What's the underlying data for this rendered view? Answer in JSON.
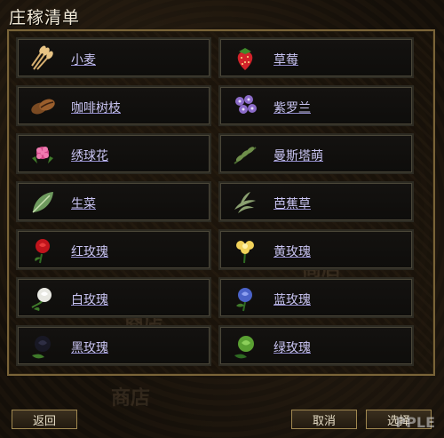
{
  "window": {
    "title": "庄稼清单"
  },
  "crops": [
    {
      "label": "小麦",
      "icon": "wheat-icon"
    },
    {
      "label": "草莓",
      "icon": "strawberry-icon"
    },
    {
      "label": "咖啡树枝",
      "icon": "coffee-bean-icon"
    },
    {
      "label": "紫罗兰",
      "icon": "violet-icon"
    },
    {
      "label": "绣球花",
      "icon": "hydrangea-icon"
    },
    {
      "label": "曼斯塔萌",
      "icon": "herb-sprig-icon"
    },
    {
      "label": "生菜",
      "icon": "lettuce-leaf-icon"
    },
    {
      "label": "芭蕉草",
      "icon": "grass-icon"
    },
    {
      "label": "红玫瑰",
      "icon": "red-rose-icon"
    },
    {
      "label": "黄玫瑰",
      "icon": "yellow-rose-icon"
    },
    {
      "label": "白玫瑰",
      "icon": "white-rose-icon"
    },
    {
      "label": "蓝玫瑰",
      "icon": "blue-rose-icon"
    },
    {
      "label": "黑玫瑰",
      "icon": "black-rose-icon"
    },
    {
      "label": "绿玫瑰",
      "icon": "green-rose-icon"
    }
  ],
  "buttons": {
    "back": "返回",
    "cancel": "取消",
    "confirm": "选择"
  },
  "watermark": "商店",
  "logo": "PPLE"
}
